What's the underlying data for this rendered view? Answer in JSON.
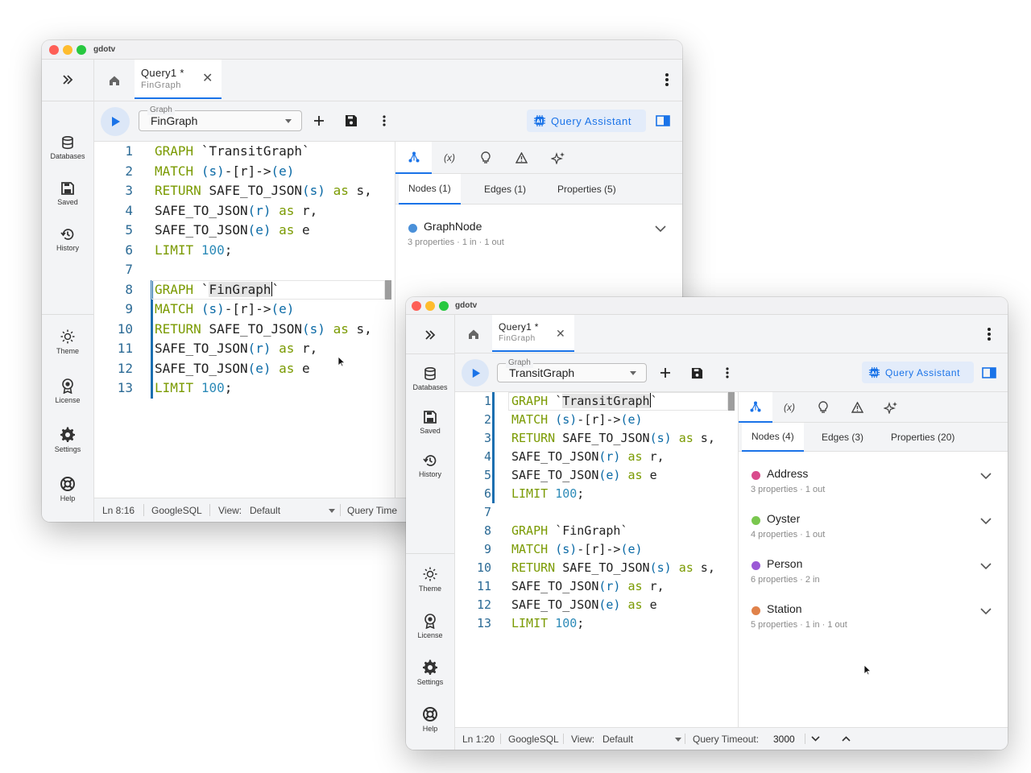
{
  "app_title": "gdotv",
  "sidebar": {
    "items": [
      {
        "label": "Databases",
        "icon": "database-icon"
      },
      {
        "label": "Saved",
        "icon": "save-icon"
      },
      {
        "label": "History",
        "icon": "history-icon"
      },
      {
        "label": "Theme",
        "icon": "theme-icon"
      },
      {
        "label": "License",
        "icon": "license-icon"
      },
      {
        "label": "Settings",
        "icon": "gear-icon"
      },
      {
        "label": "Help",
        "icon": "help-icon"
      }
    ]
  },
  "toolbar": {
    "graph_label": "Graph",
    "query_assistant_label": "Query Assistant",
    "add_icon": "plus-icon",
    "save_icon": "save-icon",
    "more_icon": "kebab-icon"
  },
  "right_panel": {
    "icon_tabs": [
      "graph-icon",
      "variables-icon",
      "lightbulb-icon",
      "warning-icon",
      "sparkle-icon"
    ],
    "variables_tab_label": "(x)"
  },
  "colors": {
    "accent": "#1a73e8",
    "keyword": "#7a9a01",
    "paren": "#0b6aa6",
    "number": "#2e8bb8",
    "line_number": "#2b6a95"
  },
  "window1": {
    "tab": {
      "name": "Query1 *",
      "subtitle": "FinGraph"
    },
    "graph_value": "FinGraph",
    "subtabs": [
      "Nodes (1)",
      "Edges (1)",
      "Properties (5)"
    ],
    "nodes": [
      {
        "name": "GraphNode",
        "meta": "3 properties · 1 in · 1 out",
        "color": "#4a90d9"
      }
    ],
    "status": {
      "position": "Ln 8:16",
      "language": "GoogleSQL",
      "view_label": "View:",
      "view_value": "Default",
      "timeout_label": "Query Time"
    }
  },
  "window2": {
    "tab": {
      "name": "Query1 *",
      "subtitle": "FinGraph"
    },
    "graph_value": "TransitGraph",
    "subtabs": [
      "Nodes (4)",
      "Edges (3)",
      "Properties (20)"
    ],
    "nodes": [
      {
        "name": "Address",
        "meta": "3 properties · 1 out",
        "color": "#d94a8c"
      },
      {
        "name": "Oyster",
        "meta": "4 properties · 1 out",
        "color": "#7ac74f"
      },
      {
        "name": "Person",
        "meta": "6 properties · 2 in",
        "color": "#9b59d6"
      },
      {
        "name": "Station",
        "meta": "5 properties · 1 in · 1 out",
        "color": "#e0824a"
      }
    ],
    "status": {
      "position": "Ln 1:20",
      "language": "GoogleSQL",
      "view_label": "View:",
      "view_value": "Default",
      "timeout_label": "Query Timeout:",
      "timeout_value": "3000"
    }
  },
  "code": {
    "line_numbers": [
      "1",
      "2",
      "3",
      "4",
      "5",
      "6",
      "7",
      "8",
      "9",
      "10",
      "11",
      "12",
      "13"
    ],
    "graph_kw": "GRAPH",
    "match_kw": "MATCH",
    "return_kw": "RETURN",
    "limit_kw": "LIMIT",
    "as_kw": "as",
    "fn": "SAFE_TO_JSON",
    "graph1_name": "TransitGraph",
    "graph2_name": "FinGraph",
    "backtick": "`",
    "pattern_a": "(s)",
    "pattern_edge": "-[r]->",
    "pattern_b": "(e)",
    "arg_s": "(s)",
    "arg_r": "(r)",
    "arg_e": "(e)",
    "alias_s": " s,",
    "alias_r": " r,",
    "alias_e": " e",
    "limit_value": "100",
    "semicolon": ";"
  }
}
